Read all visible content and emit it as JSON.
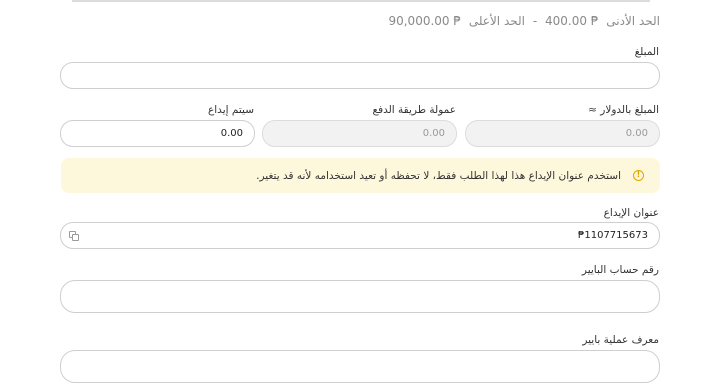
{
  "limits": {
    "min_label": "الحد الأدنى",
    "min_value": "₱ 400.00",
    "separator": "-",
    "max_label": "الحد الأعلى",
    "max_value": "₱ 90,000.00"
  },
  "amount": {
    "label": "المبلغ",
    "value": ""
  },
  "usd_amount": {
    "label": "المبلغ بالدولار ≈",
    "value": "0.00"
  },
  "payment_fee": {
    "label": "عمولة طريقة الدفع",
    "value": "0.00"
  },
  "deposit_total": {
    "label": "سيتم إيداع",
    "value": "0.00"
  },
  "notice": {
    "icon": "warning-circle-icon",
    "text": "استخدم عنوان الإيداع هذا لهذا الطلب فقط، لا تحفظه أو تعيد استخدامه لأنه قد يتغير.",
    "accent": "#e0a400",
    "background": "#fdf7dc"
  },
  "deposit_address": {
    "label": "عنوان الإيداع",
    "value": "₱1107715673",
    "copy_icon": "copy-icon"
  },
  "payer_account": {
    "label": "رقم حساب البايير",
    "value": ""
  },
  "payer_transaction": {
    "label": "معرف عملية بايير",
    "value": ""
  }
}
